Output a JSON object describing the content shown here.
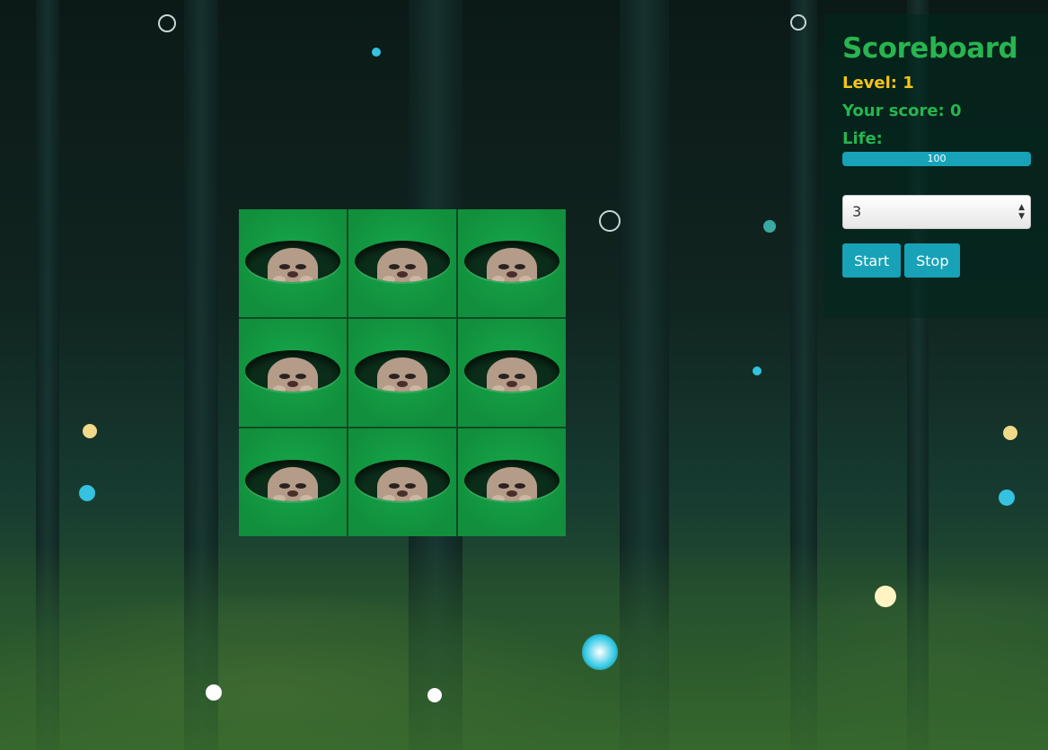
{
  "scoreboard": {
    "title": "Scoreboard",
    "level": "Level: 1",
    "score": "Your score: 0",
    "life_label": "Life:",
    "life_value": "100",
    "life_percent": 100,
    "select_value": "3",
    "start_label": "Start",
    "stop_label": "Stop"
  },
  "board": {
    "rows": 3,
    "cols": 3,
    "cells": [
      "mole",
      "mole",
      "mole",
      "mole",
      "mole",
      "mole",
      "mole",
      "mole",
      "mole"
    ]
  },
  "colors": {
    "title_green": "#28b44f",
    "level_yellow": "#f5c518",
    "button_teal": "#17a2b8",
    "grass_green": "#17a84a"
  }
}
